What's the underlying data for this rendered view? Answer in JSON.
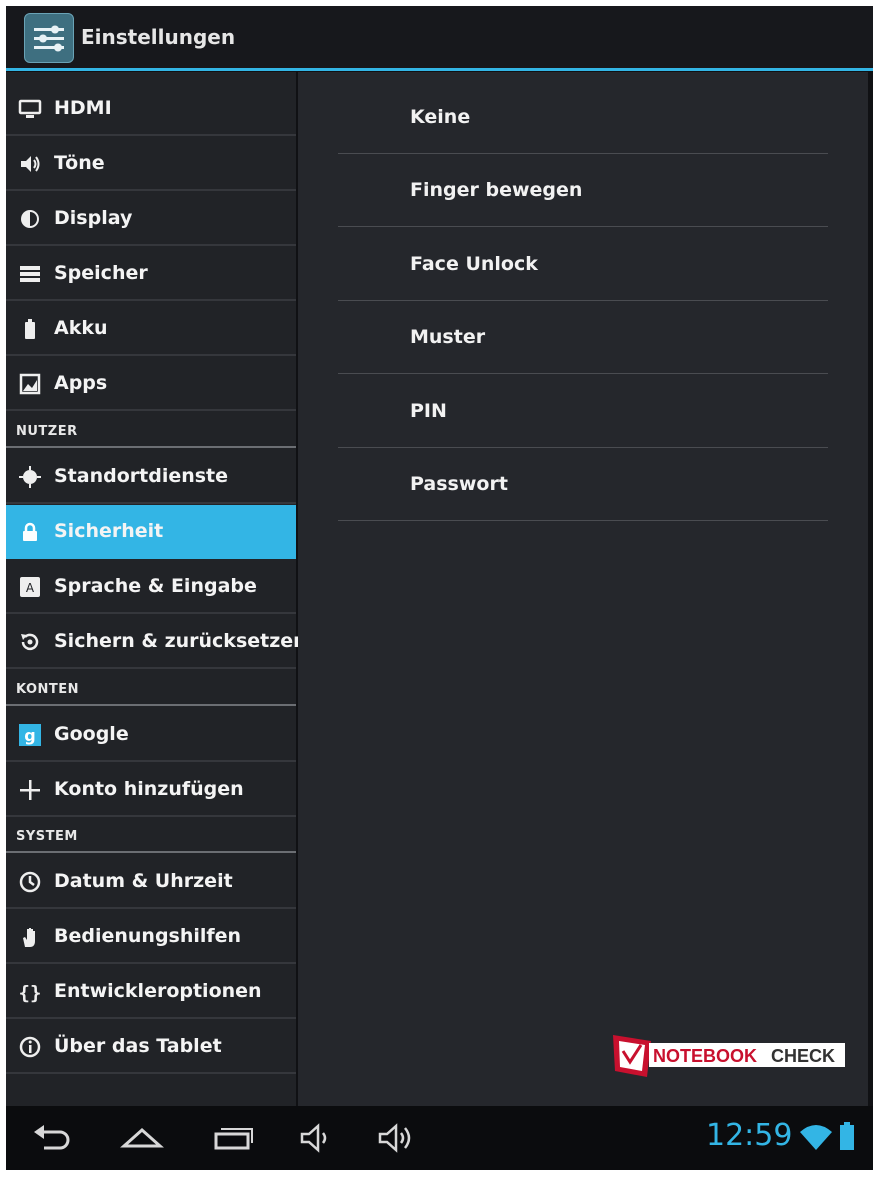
{
  "app": {
    "title": "Einstellungen"
  },
  "sidebar": {
    "items": [
      {
        "label": "HDMI",
        "icon": "monitor-icon"
      },
      {
        "label": "Töne",
        "icon": "speaker-icon"
      },
      {
        "label": "Display",
        "icon": "brightness-icon"
      },
      {
        "label": "Speicher",
        "icon": "storage-icon"
      },
      {
        "label": "Akku",
        "icon": "battery-icon"
      },
      {
        "label": "Apps",
        "icon": "apps-icon"
      }
    ],
    "section_user": "NUTZER",
    "user_items": [
      {
        "label": "Standortdienste",
        "icon": "location-icon"
      },
      {
        "label": "Sicherheit",
        "icon": "lock-icon",
        "selected": true
      },
      {
        "label": "Sprache & Eingabe",
        "icon": "keyboard-icon"
      },
      {
        "label": "Sichern & zurücksetzen",
        "icon": "backup-icon"
      }
    ],
    "section_accounts": "KONTEN",
    "account_items": [
      {
        "label": "Google",
        "icon": "google-icon"
      },
      {
        "label": "Konto hinzufügen",
        "icon": "plus-icon"
      }
    ],
    "section_system": "SYSTEM",
    "system_items": [
      {
        "label": "Datum & Uhrzeit",
        "icon": "clock-icon"
      },
      {
        "label": "Bedienungshilfen",
        "icon": "hand-icon"
      },
      {
        "label": "Entwickleroptionen",
        "icon": "braces-icon"
      },
      {
        "label": "Über das Tablet",
        "icon": "info-icon"
      }
    ]
  },
  "screen_lock_options": [
    "Keine",
    "Finger bewegen",
    "Face Unlock",
    "Muster",
    "PIN",
    "Passwort"
  ],
  "watermark": {
    "text_a": "NOTEBOOK",
    "text_b": "CHECK"
  },
  "status": {
    "time": "12:59"
  },
  "colors": {
    "accent": "#33b5e5",
    "background": "#25272c",
    "sidebar": "#212327"
  }
}
